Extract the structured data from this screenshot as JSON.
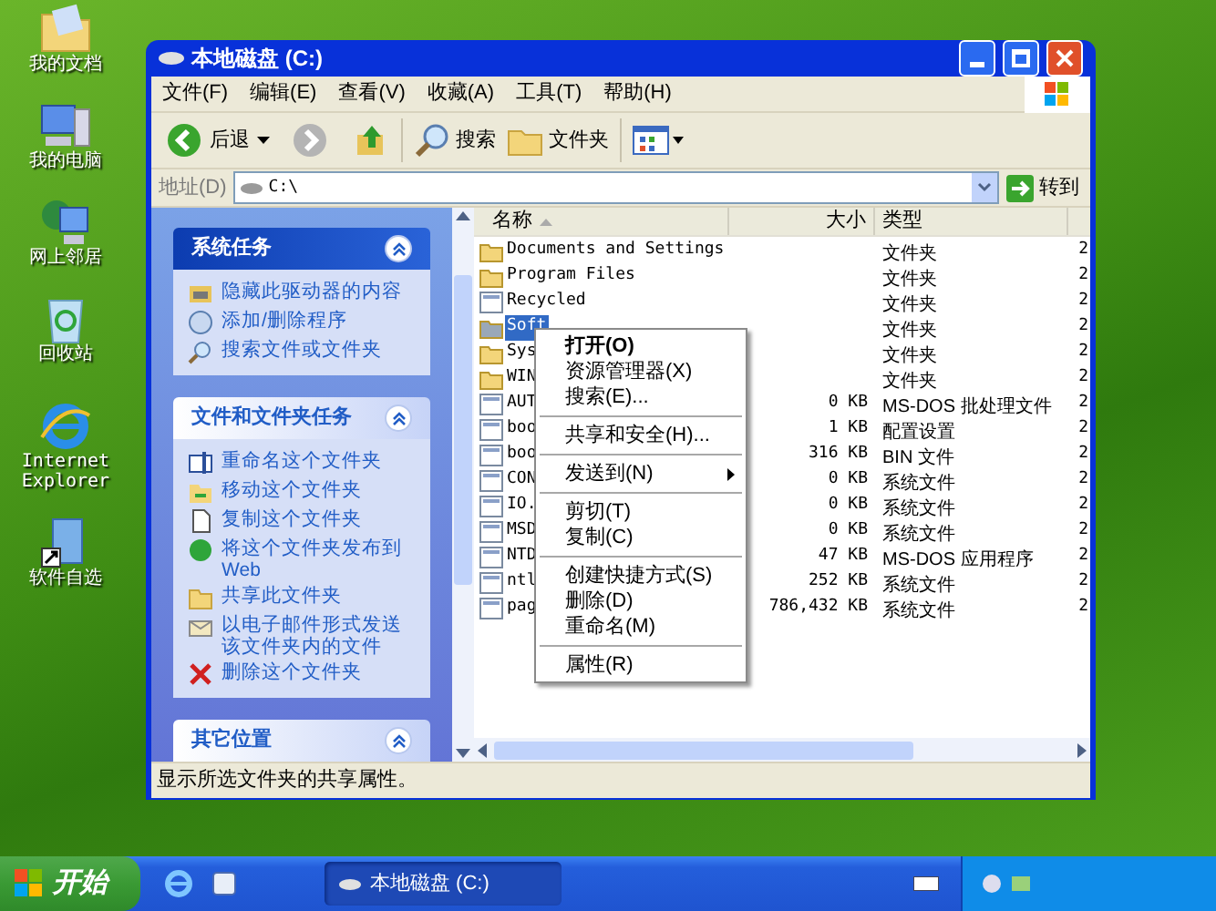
{
  "desktop_icons": [
    {
      "label": "我的文档"
    },
    {
      "label": "我的电脑"
    },
    {
      "label": "网上邻居"
    },
    {
      "label": "回收站"
    },
    {
      "label": "Internet Explorer"
    },
    {
      "label": "软件自选"
    }
  ],
  "window": {
    "title": "本地磁盘 (C:)"
  },
  "menu_bar": [
    "文件(F)",
    "编辑(E)",
    "查看(V)",
    "收藏(A)",
    "工具(T)",
    "帮助(H)"
  ],
  "toolbar": {
    "back": "后退",
    "search": "搜索",
    "folders": "文件夹"
  },
  "address": {
    "label": "地址(D)",
    "value": "C:\\",
    "go": "转到"
  },
  "task_panels": [
    {
      "kind": "special",
      "title": "系统任务",
      "items": [
        "隐藏此驱动器的内容",
        "添加/删除程序",
        "搜索文件或文件夹"
      ]
    },
    {
      "kind": "normal",
      "title": "文件和文件夹任务",
      "items": [
        "重命名这个文件夹",
        "移动这个文件夹",
        "复制这个文件夹",
        "将这个文件夹发布到 Web",
        "共享此文件夹",
        "以电子邮件形式发送该文件夹内的文件",
        "删除这个文件夹"
      ]
    },
    {
      "kind": "normal",
      "title": "其它位置"
    }
  ],
  "file_list": {
    "columns": [
      "名称",
      "大小",
      "类型"
    ],
    "rows": [
      {
        "kind": "folder",
        "name": "Documents and Settings",
        "size": "",
        "type": "文件夹",
        "column_4": "2",
        "selected": false
      },
      {
        "kind": "folder",
        "name": "Program Files",
        "size": "",
        "type": "文件夹",
        "column_4": "2",
        "selected": false
      },
      {
        "kind": "file",
        "name": "Recycled",
        "size": "",
        "type": "文件夹",
        "column_4": "2",
        "selected": false
      },
      {
        "kind": "folder",
        "name": "Soft",
        "size": "",
        "type": "文件夹",
        "column_4": "2",
        "selected": true
      },
      {
        "kind": "folder",
        "name": "Sys",
        "size": "",
        "type": "文件夹",
        "column_4": "2",
        "selected": false
      },
      {
        "kind": "folder",
        "name": "WIN",
        "size": "",
        "type": "文件夹",
        "column_4": "2",
        "selected": false
      },
      {
        "kind": "file",
        "name": "AUT",
        "size": "0 KB",
        "type": "MS-DOS 批处理文件",
        "column_4": "2",
        "selected": false
      },
      {
        "kind": "file",
        "name": "boo",
        "size": "1 KB",
        "type": "配置设置",
        "column_4": "2",
        "selected": false
      },
      {
        "kind": "file",
        "name": "boo",
        "size": "316 KB",
        "type": "BIN 文件",
        "column_4": "2",
        "selected": false
      },
      {
        "kind": "file",
        "name": "CON",
        "size": "0 KB",
        "type": "系统文件",
        "column_4": "2",
        "selected": false
      },
      {
        "kind": "file",
        "name": "IO.",
        "size": "0 KB",
        "type": "系统文件",
        "column_4": "2",
        "selected": false
      },
      {
        "kind": "file",
        "name": "MSD",
        "size": "0 KB",
        "type": "系统文件",
        "column_4": "2",
        "selected": false
      },
      {
        "kind": "file",
        "name": "NTD",
        "size": "47 KB",
        "type": "MS-DOS 应用程序",
        "column_4": "2",
        "selected": false
      },
      {
        "kind": "file",
        "name": "ntl",
        "size": "252 KB",
        "type": "系统文件",
        "column_4": "2",
        "selected": false
      },
      {
        "kind": "file",
        "name": "pag",
        "size": "786,432 KB",
        "type": "系统文件",
        "column_4": "2",
        "selected": false
      }
    ]
  },
  "context_menu": {
    "groups": [
      [
        {
          "label": "打开(O)",
          "default": true,
          "submenu": false
        },
        {
          "label": "资源管理器(X)",
          "default": false,
          "submenu": false
        },
        {
          "label": "搜索(E)...",
          "default": false,
          "submenu": false
        }
      ],
      [
        {
          "label": "共享和安全(H)...",
          "default": false,
          "submenu": false
        }
      ],
      [
        {
          "label": "发送到(N)",
          "default": false,
          "submenu": true
        }
      ],
      [
        {
          "label": "剪切(T)",
          "default": false,
          "submenu": false
        },
        {
          "label": "复制(C)",
          "default": false,
          "submenu": false
        }
      ],
      [
        {
          "label": "创建快捷方式(S)",
          "default": false,
          "submenu": false
        },
        {
          "label": "删除(D)",
          "default": false,
          "submenu": false
        },
        {
          "label": "重命名(M)",
          "default": false,
          "submenu": false
        }
      ],
      [
        {
          "label": "属性(R)",
          "default": false,
          "submenu": false
        }
      ]
    ]
  },
  "status_bar": "显示所选文件夹的共享属性。",
  "taskbar": {
    "start": "开始",
    "tasks": [
      {
        "label": "本地磁盘 (C:)",
        "selected": true
      }
    ]
  }
}
